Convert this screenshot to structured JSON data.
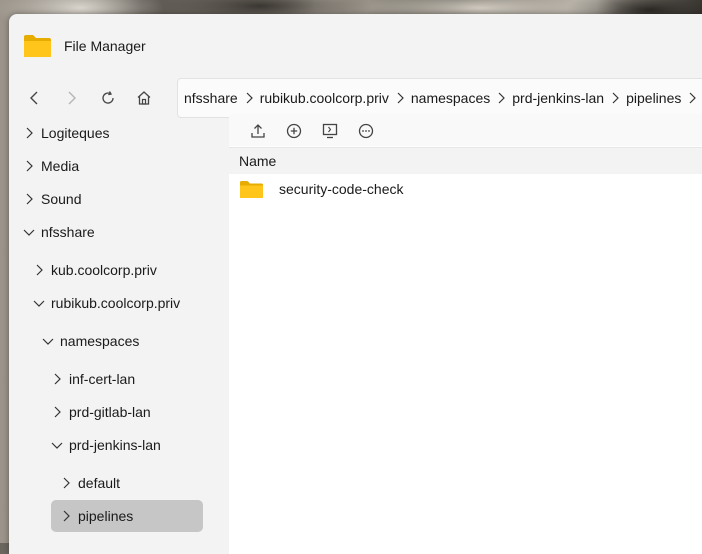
{
  "window": {
    "title": "File Manager"
  },
  "nav": {
    "back_icon": "chevron-left-icon",
    "forward_icon": "chevron-right-icon",
    "refresh_icon": "refresh-icon",
    "home_icon": "home-icon"
  },
  "breadcrumb": [
    "nfsshare",
    "rubikub.coolcorp.priv",
    "namespaces",
    "prd-jenkins-lan",
    "pipelines"
  ],
  "sidebar": {
    "items": [
      {
        "label": "Logiteques",
        "expanded": false,
        "level": 0
      },
      {
        "label": "Media",
        "expanded": false,
        "level": 0
      },
      {
        "label": "Sound",
        "expanded": false,
        "level": 0
      },
      {
        "label": "nfsshare",
        "expanded": true,
        "level": 0
      },
      {
        "label": "kub.coolcorp.priv",
        "expanded": false,
        "level": 1
      },
      {
        "label": "rubikub.coolcorp.priv",
        "expanded": true,
        "level": 1
      },
      {
        "label": "namespaces",
        "expanded": true,
        "level": 2
      },
      {
        "label": "inf-cert-lan",
        "expanded": false,
        "level": 3
      },
      {
        "label": "prd-gitlab-lan",
        "expanded": false,
        "level": 3
      },
      {
        "label": "prd-jenkins-lan",
        "expanded": true,
        "level": 3
      },
      {
        "label": "default",
        "expanded": false,
        "level": 4
      },
      {
        "label": "pipelines",
        "expanded": false,
        "level": 4,
        "selected": true
      }
    ]
  },
  "toolbar": {
    "icons": [
      "upload-icon",
      "new-folder-icon",
      "terminal-icon",
      "more-options-icon"
    ]
  },
  "files": {
    "column_name": "Name",
    "rows": [
      {
        "name": "security-code-check",
        "type": "folder"
      }
    ]
  },
  "colors": {
    "folder": "#f5c000",
    "selected": "#c6c6c6",
    "window_bg": "#f3f3f3"
  }
}
